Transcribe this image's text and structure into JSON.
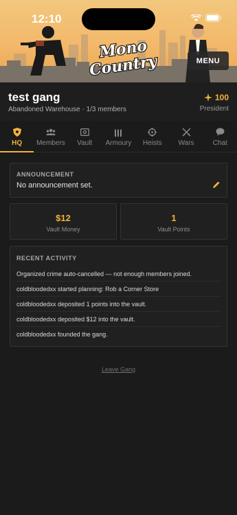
{
  "status_bar": {
    "time": "12:10"
  },
  "header": {
    "logo_line1": "Mono",
    "logo_line2": "Country",
    "menu_label": "MENU"
  },
  "gang": {
    "name": "test gang",
    "subtitle": "Abandoned Warehouse · 1/3 members",
    "points": "100",
    "rank": "President"
  },
  "tabs": [
    {
      "label": "HQ",
      "icon": "shield-icon"
    },
    {
      "label": "Members",
      "icon": "users-icon"
    },
    {
      "label": "Vault",
      "icon": "vault-icon"
    },
    {
      "label": "Armoury",
      "icon": "ammo-icon"
    },
    {
      "label": "Heists",
      "icon": "crosshair-icon"
    },
    {
      "label": "Wars",
      "icon": "crossed-swords-icon"
    },
    {
      "label": "Chat",
      "icon": "chat-icon"
    }
  ],
  "announcement": {
    "title": "ANNOUNCEMENT",
    "text": "No announcement set."
  },
  "stats": {
    "money_value": "$12",
    "money_label": "Vault Money",
    "points_value": "1",
    "points_label": "Vault Points"
  },
  "activity": {
    "title": "RECENT ACTIVITY",
    "items": [
      "Organized crime auto-cancelled — not enough members joined.",
      "coldbloodedxx started planning: Rob a Corner Store",
      "coldbloodedxx deposited 1 points into the vault.",
      "coldbloodedxx deposited $12 into the vault.",
      "coldbloodedxx founded the gang."
    ]
  },
  "leave_label": "Leave Gang",
  "colors": {
    "accent": "#f2b23a",
    "background": "#1b1b1b",
    "card": "#202020"
  }
}
